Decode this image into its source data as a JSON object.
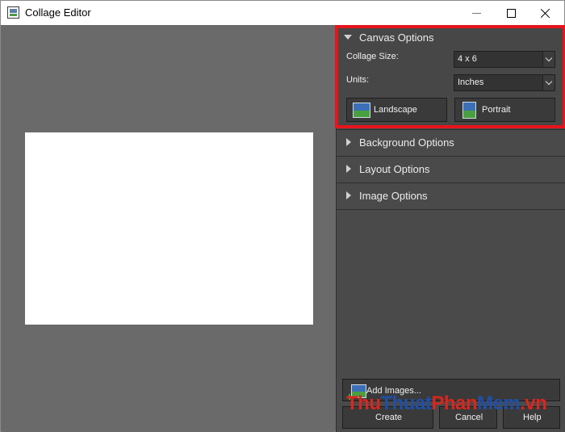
{
  "window": {
    "title": "Collage Editor"
  },
  "canvas_options": {
    "title": "Canvas Options",
    "collage_size": {
      "label": "Collage Size:",
      "value": "4 x 6"
    },
    "units": {
      "label": "Units:",
      "value": "Inches"
    },
    "landscape_label": "Landscape",
    "portrait_label": "Portrait"
  },
  "sections": [
    {
      "title": "Background Options"
    },
    {
      "title": "Layout Options"
    },
    {
      "title": "Image Options"
    }
  ],
  "buttons": {
    "add_images": "Add Images...",
    "create": "Create",
    "cancel": "Cancel",
    "help": "Help"
  },
  "watermark": {
    "part1": "Thu",
    "part2": "Thuat",
    "part3": "Phan",
    "part4": "Mem",
    "part5": ".vn"
  },
  "colors": {
    "highlight": "#e8141c",
    "panel": "#4a4a4a",
    "preview": "#6a6a6a"
  }
}
